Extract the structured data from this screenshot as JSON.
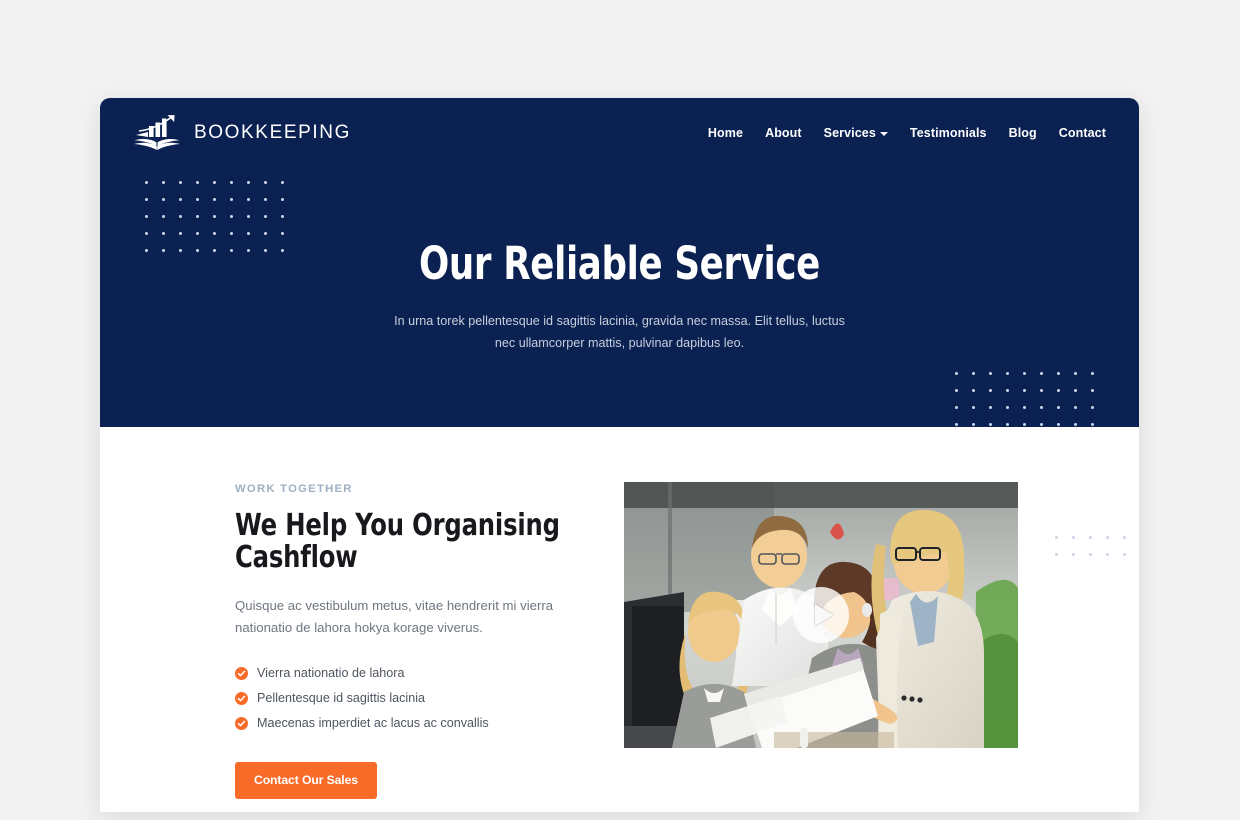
{
  "site": {
    "brand_name": "BOOKKEEPING",
    "logo_icon": "chart-book-logo-icon",
    "navy": "#0a2151",
    "accent": "#f96b28"
  },
  "nav": {
    "items": [
      {
        "label": "Home",
        "has_dropdown": false
      },
      {
        "label": "About",
        "has_dropdown": false
      },
      {
        "label": "Services",
        "has_dropdown": true
      },
      {
        "label": "Testimonials",
        "has_dropdown": false
      },
      {
        "label": "Blog",
        "has_dropdown": false
      },
      {
        "label": "Contact",
        "has_dropdown": false
      }
    ]
  },
  "hero": {
    "title": "Our Reliable Service",
    "subtitle": "In urna torek pellentesque id sagittis lacinia, gravida nec massa. Elit tellus, luctus nec ullamcorper mattis, pulvinar dapibus leo."
  },
  "section": {
    "eyebrow": "WORK TOGETHER",
    "title": "We Help You Organising Cashflow",
    "body": "Quisque ac vestibulum metus, vitae hendrerit mi vierra nationatio de lahora hokya korage viverus.",
    "features": [
      "Vierra nationatio de lahora",
      "Pellentesque id sagittis lacinia",
      "Maecenas imperdiet ac lacus ac convallis"
    ],
    "cta_label": "Contact Our Sales",
    "video": {
      "alt": "Four office colleagues reviewing a document together",
      "play_icon": "play-icon"
    }
  }
}
